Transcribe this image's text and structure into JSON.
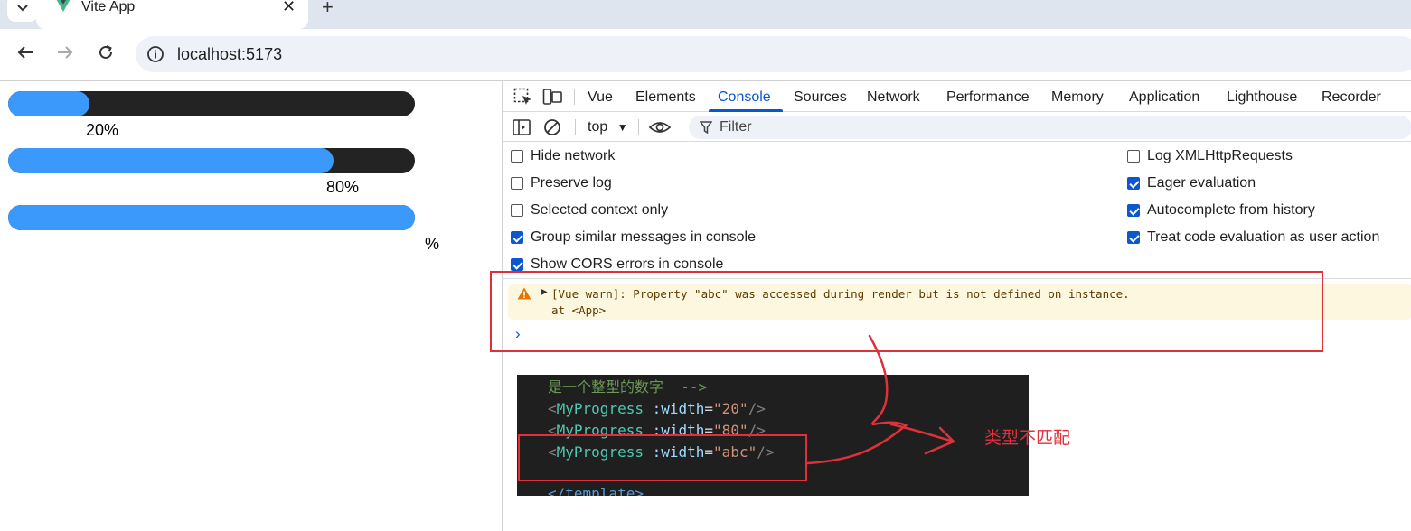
{
  "browser": {
    "tab_title": "Vite App",
    "url": "localhost:5173"
  },
  "page": {
    "progress_bars": [
      {
        "label": "20%",
        "value": 0.2
      },
      {
        "label": "80%",
        "value": 0.8
      },
      {
        "label": "%",
        "value": 1.0
      }
    ]
  },
  "devtools": {
    "tabs": [
      "Vue",
      "Elements",
      "Console",
      "Sources",
      "Network",
      "Performance",
      "Memory",
      "Application",
      "Lighthouse",
      "Recorder"
    ],
    "active_tab": "Console",
    "context": "top",
    "filter_placeholder": "Filter",
    "settings_left": [
      {
        "label": "Hide network",
        "checked": false
      },
      {
        "label": "Preserve log",
        "checked": false
      },
      {
        "label": "Selected context only",
        "checked": false
      },
      {
        "label": "Group similar messages in console",
        "checked": true
      },
      {
        "label": "Show CORS errors in console",
        "checked": true
      }
    ],
    "settings_right": [
      {
        "label": "Log XMLHttpRequests",
        "checked": false
      },
      {
        "label": "Eager evaluation",
        "checked": true
      },
      {
        "label": "Autocomplete from history",
        "checked": true
      },
      {
        "label": "Treat code evaluation as user action",
        "checked": true
      }
    ],
    "warning": {
      "line1": "[Vue warn]: Property \"abc\" was accessed during render but is not defined on instance.",
      "line2": "at <App>"
    },
    "prompt": "›"
  },
  "annotation": {
    "code_lines": {
      "comment": "是一个整型的数字  -->",
      "line1": {
        "open": "<",
        "tag": "MyProgress",
        "attr": ":width",
        "eq": "=",
        "val": "\"20\"",
        "close": "/>"
      },
      "line2": {
        "open": "<",
        "tag": "MyProgress",
        "attr": ":width",
        "eq": "=",
        "val": "\"80\"",
        "close": "/>"
      },
      "line3": {
        "open": "<",
        "tag": "MyProgress",
        "attr": ":width",
        "eq": "=",
        "val": "\"abc\"",
        "close": "/>"
      },
      "end_tag": "</template>"
    },
    "note": "类型不匹配",
    "accent_color": "#e0303a"
  }
}
